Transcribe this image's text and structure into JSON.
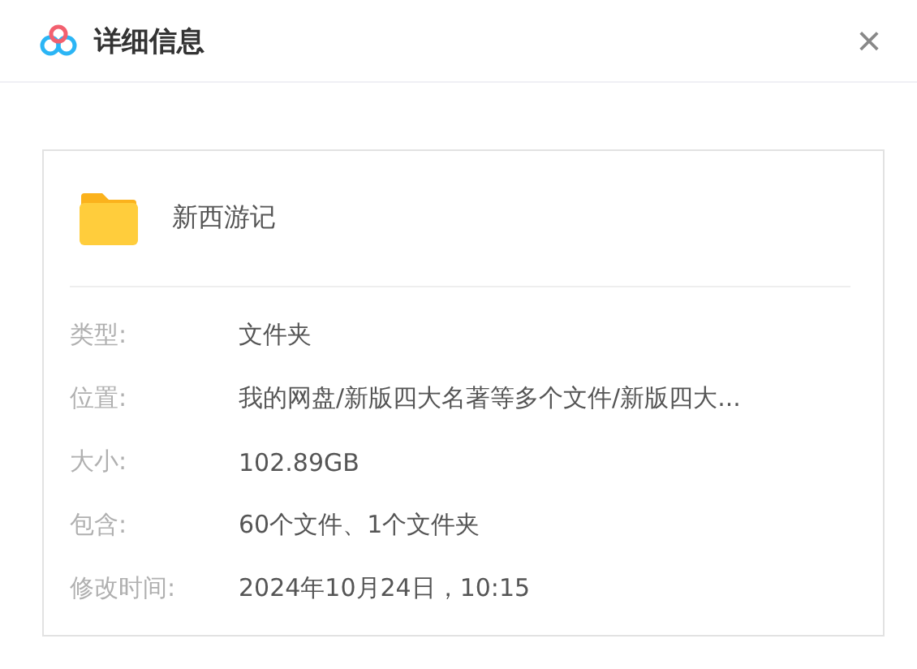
{
  "window": {
    "title": "详细信息",
    "close": "×"
  },
  "file": {
    "name": "新西游记",
    "kind": "folder"
  },
  "details": [
    {
      "label": "类型:",
      "value": "文件夹"
    },
    {
      "label": "位置:",
      "value": "我的网盘/新版四大名著等多个文件/新版四大..."
    },
    {
      "label": "大小:",
      "value": "102.89GB"
    },
    {
      "label": "包含:",
      "value": "60个文件、1个文件夹"
    },
    {
      "label": "修改时间:",
      "value": "2024年10月24日，10:15"
    }
  ]
}
